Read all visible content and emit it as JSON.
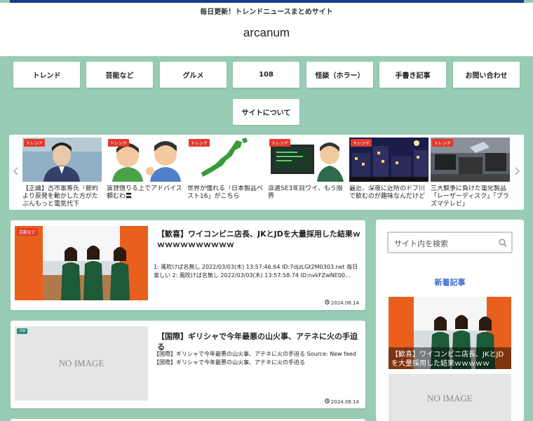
{
  "header": {
    "tagline": "毎日更新！トレンドニュースまとめサイト",
    "logo": "arcanum"
  },
  "nav": [
    "トレンド",
    "芸能など",
    "グルメ",
    "108",
    "怪談（ホラー）",
    "手書き記事",
    "お問い合わせ",
    "サイトについて"
  ],
  "carousel": {
    "items": [
      {
        "tag": "トレンド",
        "title": "【正論】古市憲寿氏「節約より原発を動かした方がたぶんもっと電気代下"
      },
      {
        "tag": "トレンド",
        "title": "賃貸借りる上でアドバイス頼むわ〓"
      },
      {
        "tag": "トレンド",
        "title": "世界が憧れる「日本製品ベスト16」がこちら"
      },
      {
        "tag": "トレンド",
        "title": "派遣SE3年目ワイ、もう限界"
      },
      {
        "tag": "トレンド",
        "title": "最近、深夜に近所のドブ川で飲むのが趣味なんだけど"
      },
      {
        "tag": "トレンド",
        "title": "三大競争に負けた電化製品「レーザーディスク」「プラズマテレビ」"
      }
    ]
  },
  "posts": [
    {
      "tag": "芸能など",
      "tag_color": "#e03c2c",
      "title": "【歓喜】ワイコンビニ店長、JKとJDを大量採用した結果ｗｗｗｗｗｗｗｗｗｗｗ",
      "snippet": "1: 風吹けば名無し 2022/03/03(木) 13:57:46.64 ID:7djzLGt2M0303.net 毎日楽しい 2: 風吹けば名無し 2022/03/03(木) 13:57:58.74 ID:nvkFZwNE00...",
      "date": "2024.08.14"
    },
    {
      "tag": "108",
      "tag_color": "#2a8a78",
      "title": "【国際】ギリシャで今年最悪の山火事、アテネに火の手迫る",
      "snippet": "【国際】ギリシャで今年最悪の山火事、アテネに火の手迫る Source: New feed 【国際】ギリシャで今年最悪の山火事、アテネに火の手迫る",
      "date": "2024.08.14",
      "image_text": "NO IMAGE"
    }
  ],
  "sidebar": {
    "search_placeholder": "サイト内を検索",
    "heading": "新着記事",
    "items": [
      {
        "title": "【歓喜】ワイコンビニ店長、JKとJDを大量採用した結果ｗｗｗｗｗ"
      },
      {
        "image_text": "NO IMAGE"
      }
    ]
  },
  "colors": {
    "background": "#99ccb4",
    "topbar": "#1a3a8a",
    "tag_red": "#e03c2c",
    "heading_blue": "#3a6ad0"
  },
  "icons": {
    "carousel_prev": "chevron-left-icon",
    "carousel_next": "chevron-right-icon",
    "search": "search-icon",
    "clock": "clock-icon"
  }
}
